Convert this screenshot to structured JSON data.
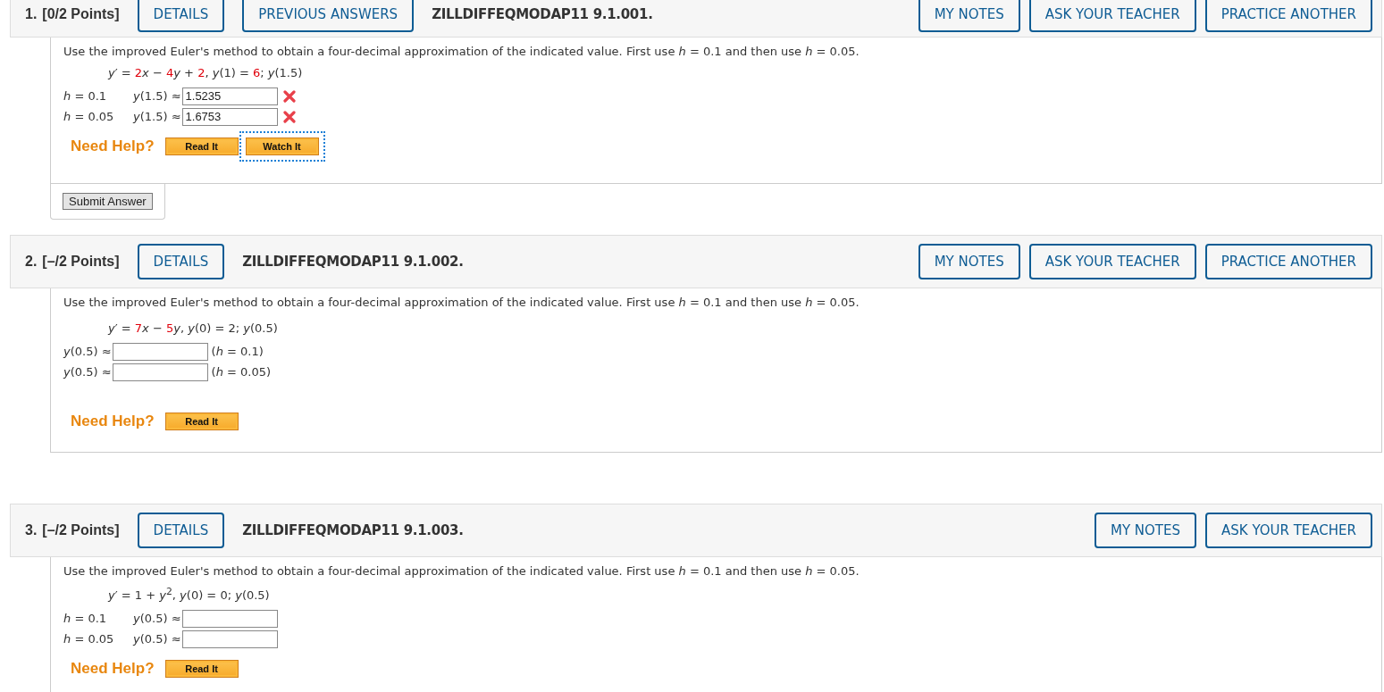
{
  "questions": [
    {
      "number": "1.",
      "points": "[0/2 Points]",
      "header_buttons": [
        "DETAILS",
        "PREVIOUS ANSWERS"
      ],
      "code": "ZILLDIFFEQMODAP11 9.1.001.",
      "right_buttons": [
        "MY NOTES",
        "ASK YOUR TEACHER",
        "PRACTICE ANOTHER"
      ],
      "instruction": "Use the improved Euler's method to obtain a four-decimal approximation of the indicated value. First use *h* = 0.1 and then use *h* = 0.05.",
      "equation": [
        {
          "text": "*y*′ = ",
          "highlight": false
        },
        {
          "text": "2",
          "highlight": true
        },
        {
          "text": "*x* − ",
          "highlight": false
        },
        {
          "text": "4",
          "highlight": true
        },
        {
          "text": "*y* + ",
          "highlight": false
        },
        {
          "text": "2",
          "highlight": true
        },
        {
          "text": ", *y*(1) = ",
          "highlight": false
        },
        {
          "text": "6",
          "highlight": true
        },
        {
          "text": ";  *y*(1.5)",
          "highlight": false
        }
      ],
      "answers": [
        {
          "label": "*h* = 0.1",
          "prefix": "*y*(1.5) ≈",
          "value": "1.5235",
          "incorrect": true
        },
        {
          "label": "*h* = 0.05",
          "prefix": "*y*(1.5) ≈",
          "value": "1.6753",
          "incorrect": true
        }
      ],
      "help_label": "Need Help?",
      "help_buttons": [
        {
          "label": "Read It",
          "focused": false
        },
        {
          "label": "Watch It",
          "focused": true
        }
      ],
      "submit": "Submit Answer"
    },
    {
      "number": "2.",
      "points": "[–/2 Points]",
      "header_buttons": [
        "DETAILS"
      ],
      "code": "ZILLDIFFEQMODAP11 9.1.002.",
      "right_buttons": [
        "MY NOTES",
        "ASK YOUR TEACHER",
        "PRACTICE ANOTHER"
      ],
      "instruction": "Use the improved Euler's method to obtain a four-decimal approximation of the indicated value. First use *h* = 0.1 and then use *h* = 0.05.",
      "equation": [
        {
          "text": "*y*′ = ",
          "highlight": false
        },
        {
          "text": "7",
          "highlight": true
        },
        {
          "text": "*x* − ",
          "highlight": false
        },
        {
          "text": "5",
          "highlight": true
        },
        {
          "text": "*y*,    *y*(0) = 2;  *y*(0.5)",
          "highlight": false
        }
      ],
      "answers": [
        {
          "prefix": "*y*(0.5) ≈",
          "suffix": "(*h* = 0.1)",
          "incorrect": false
        },
        {
          "prefix": "*y*(0.5) ≈",
          "suffix": "(*h* = 0.05)",
          "incorrect": false
        }
      ],
      "help_label": "Need Help?",
      "help_buttons": [
        {
          "label": "Read It",
          "focused": false
        }
      ]
    },
    {
      "number": "3.",
      "points": "[–/2 Points]",
      "header_buttons": [
        "DETAILS"
      ],
      "code": "ZILLDIFFEQMODAP11 9.1.003.",
      "right_buttons": [
        "MY NOTES",
        "ASK YOUR TEACHER"
      ],
      "instruction": "Use the improved Euler's method to obtain a four-decimal approximation of the indicated value. First use *h* = 0.1 and then use *h* = 0.05.",
      "equation": [
        {
          "text": "*y*′ = 1 + *y*$^{2}$, *y*(0) = 0;  *y*(0.5)",
          "highlight": false
        }
      ],
      "answers": [
        {
          "label": "*h* = 0.1",
          "prefix": "*y*(0.5) ≈",
          "incorrect": false
        },
        {
          "label": "*h* = 0.05",
          "prefix": "*y*(0.5) ≈",
          "incorrect": false
        }
      ],
      "help_label": "Need Help?",
      "help_buttons": [
        {
          "label": "Read It",
          "focused": false
        }
      ]
    }
  ]
}
